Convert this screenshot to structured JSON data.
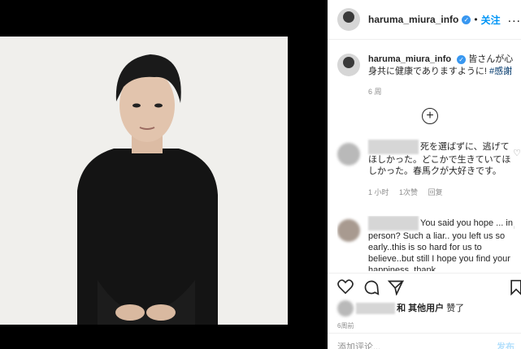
{
  "header": {
    "username": "haruma_miura_info",
    "follow_label": "关注",
    "separator": "•",
    "more_label": "..."
  },
  "caption": {
    "username": "haruma_miura_info",
    "text": "皆さんが心身共に健康でありますように!",
    "hashtag": "#感謝",
    "age": "6 周"
  },
  "comments": [
    {
      "text_visible": "死を選ばずに、逃げてほしかった。どこかで生きていてほしかった。春馬クが大好きです。",
      "time": "1 小时",
      "likes": "1次赞",
      "reply": "回复"
    },
    {
      "text_visible": "You said you hope ... in person? Such a liar.. you left us so early..this is so hard for us to believe..but still I hope you find your happiness. thank"
    }
  ],
  "likes": {
    "and_others": "和 其他用户",
    "liked": "赞了"
  },
  "post_age": "6周前",
  "add_comment_placeholder": "添加评论...",
  "post_label": "发布",
  "colors": {
    "follow": "#0095f6",
    "verified": "#3897f0",
    "hashtag": "#00376b"
  }
}
